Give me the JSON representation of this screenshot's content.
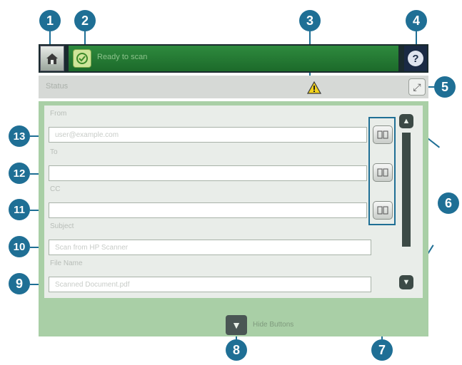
{
  "status": {
    "message": "Ready to scan"
  },
  "notification": {
    "text": "Status"
  },
  "help": {
    "label": "?"
  },
  "form": {
    "fields": [
      {
        "label": "From",
        "value": "user@example.com"
      },
      {
        "label": "To",
        "value": ""
      },
      {
        "label": "CC",
        "value": ""
      },
      {
        "label": "Subject",
        "value": "Scan from HP Scanner"
      },
      {
        "label": "File Name",
        "value": "Scanned Document.pdf"
      }
    ]
  },
  "footer": {
    "label": "Hide Buttons"
  },
  "callouts": [
    "1",
    "2",
    "3",
    "4",
    "5",
    "6",
    "7",
    "8",
    "9",
    "10",
    "11",
    "12",
    "13"
  ]
}
